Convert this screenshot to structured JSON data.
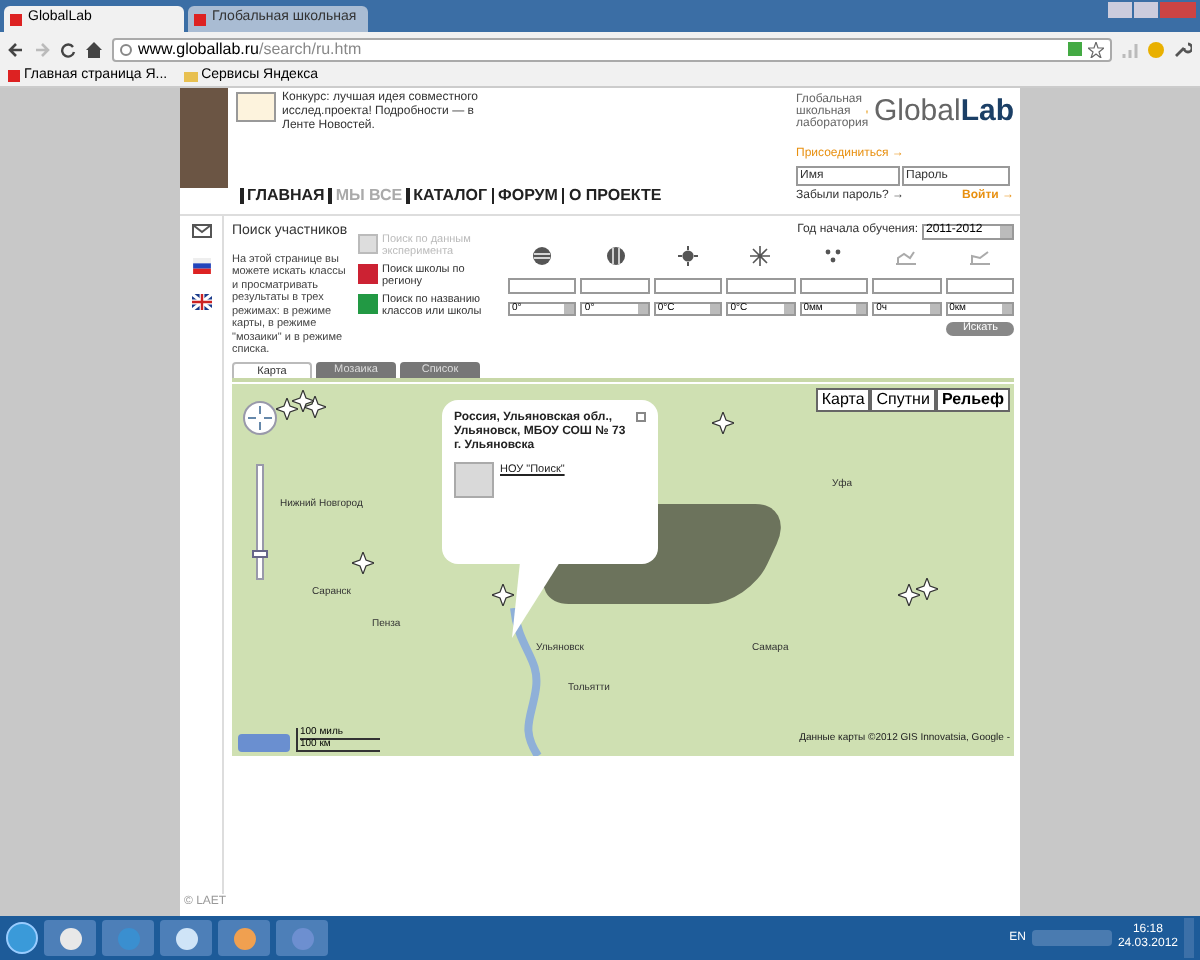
{
  "browser": {
    "tabs": [
      {
        "title": "GlobalLab",
        "selected": true
      },
      {
        "title": "Глобальная школьная",
        "selected": false
      }
    ],
    "address": {
      "host": "www.globallab.ru",
      "path": "/search/ru.htm"
    },
    "bookmarks": [
      "Главная страница Я...",
      "Сервисы Яндекса"
    ]
  },
  "header": {
    "news": "Конкурс: лучшая идея совместного исслед.проекта! Подробности — в Ленте Новостей.",
    "tagline": "Глобальная школьная лаборатория",
    "logo": {
      "light": "Global",
      "bold": "Lab"
    },
    "join": "Присоединиться →",
    "login": {
      "name_placeholder": "Имя",
      "password_placeholder": "Пароль",
      "forgot": "Забыли пароль? →",
      "submit": "Войти →"
    }
  },
  "nav": [
    {
      "label": "ГЛАВНАЯ",
      "selected": false
    },
    {
      "label": "МЫ ВСЕ",
      "selected": true
    },
    {
      "label": "КАТАЛОГ",
      "selected": false
    },
    {
      "label": "ФОРУМ",
      "selected": false
    },
    {
      "label": "О ПРОЕКТЕ",
      "selected": false
    }
  ],
  "search": {
    "title": "Поиск участников",
    "description": "На этой странице вы можете искать классы и просматривать результаты в трех режимах: в режиме карты, в режиме \"мозаики\" и в режиме списка.",
    "modes": [
      {
        "label": "Поиск по данным эксперимента",
        "disabled": true
      },
      {
        "label": "Поиск школы по региону",
        "disabled": false
      },
      {
        "label": "Поиск по названию классов или школы",
        "disabled": false
      }
    ],
    "year_label": "Год начала обучения:",
    "year": "2011-2012",
    "filters": [
      {
        "kind": "globe",
        "unit": "0°"
      },
      {
        "kind": "meridian",
        "unit": "0°"
      },
      {
        "kind": "sun",
        "unit": "0°C"
      },
      {
        "kind": "snow",
        "unit": "0°C"
      },
      {
        "kind": "rain",
        "unit": "0мм"
      },
      {
        "kind": "hours",
        "unit": "0ч"
      },
      {
        "kind": "distance",
        "unit": "0км"
      }
    ],
    "submit": "Искать"
  },
  "view_tabs": [
    {
      "label": "Карта",
      "selected": true
    },
    {
      "label": "Мозаика",
      "selected": false
    },
    {
      "label": "Список",
      "selected": false
    }
  ],
  "map": {
    "types": [
      {
        "label": "Карта",
        "selected": false
      },
      {
        "label": "Спутни",
        "selected": false
      },
      {
        "label": "Рельеф",
        "selected": true
      }
    ],
    "zoom": {
      "level": 0.2
    },
    "cities": [
      "Нижний Новгород",
      "Саранск",
      "Ульяновск",
      "Тольятти",
      "Уфа",
      "Пенза",
      "Самара"
    ],
    "popup": {
      "address": "Россия, Ульяновская обл., Ульяновск, МБОУ СОШ № 73 г. Ульяновска",
      "link": "НОУ \"Поиск\""
    },
    "scale": [
      "100 миль",
      "100 км"
    ],
    "attribution": "Данные карты ©2012 GIS Innovatsia, Google -"
  },
  "footer": "© LAET",
  "taskbar": {
    "language": "EN",
    "time": "16:18",
    "date": "24.03.2012"
  }
}
